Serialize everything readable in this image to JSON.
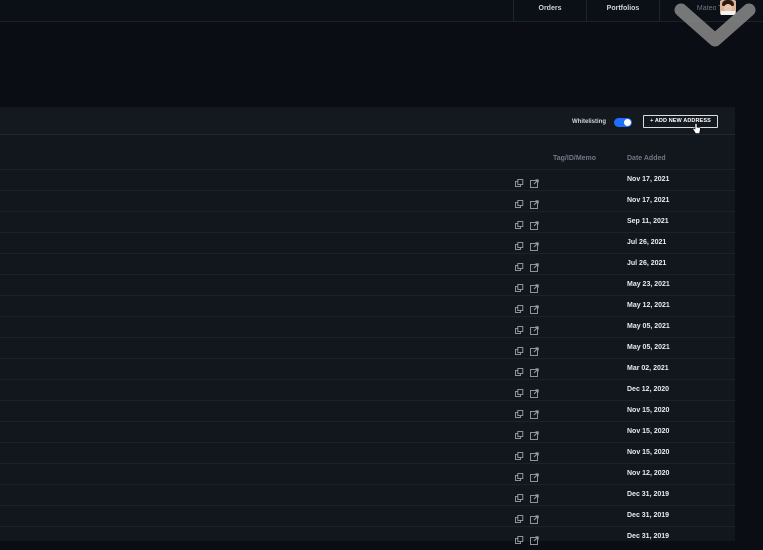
{
  "topnav": {
    "orders_label": "Orders",
    "portfolios_label": "Portfolios",
    "user_label": "Mateo Tu"
  },
  "header": {
    "whitelisting_label": "Whitelisting",
    "whitelisting_on": true,
    "add_address_label": "+ ADD NEW ADDRESS"
  },
  "table": {
    "columns": [
      "Tag/ID/Memo",
      "Date Added"
    ],
    "rows": [
      {
        "date": "Nov 17, 2021"
      },
      {
        "date": "Nov 17, 2021"
      },
      {
        "date": "Sep 11, 2021"
      },
      {
        "date": "Jul 26, 2021"
      },
      {
        "date": "Jul 26, 2021"
      },
      {
        "date": "May 23, 2021"
      },
      {
        "date": "May 12, 2021"
      },
      {
        "date": "May 05, 2021"
      },
      {
        "date": "May 05, 2021"
      },
      {
        "date": "Mar 02, 2021"
      },
      {
        "date": "Dec 12, 2020"
      },
      {
        "date": "Nov 15, 2020"
      },
      {
        "date": "Nov 15, 2020"
      },
      {
        "date": "Nov 15, 2020"
      },
      {
        "date": "Nov 12, 2020"
      },
      {
        "date": "Dec 31, 2019"
      },
      {
        "date": "Dec 31, 2019"
      },
      {
        "date": "Dec 31, 2019"
      }
    ]
  },
  "icons": {
    "copy": "copy-icon",
    "external": "external-link-icon"
  },
  "colors": {
    "accent": "#1f6fff",
    "background": "#0a0d13",
    "panel": "#12171e"
  }
}
